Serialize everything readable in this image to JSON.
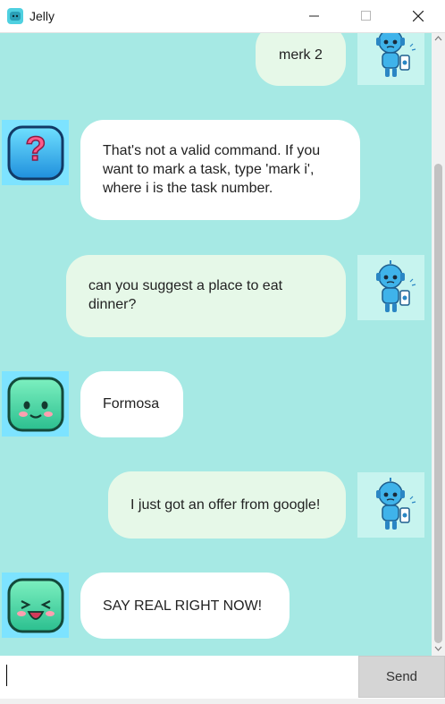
{
  "window": {
    "title": "Jelly",
    "icon": "jelly-app-icon"
  },
  "messages": [
    {
      "sender": "user",
      "text": "merk 2",
      "avatar": "robot-avatar"
    },
    {
      "sender": "bot",
      "lines": [
        "That's not a valid command. If you",
        "want to mark a task, type 'mark i',",
        "where i is the task number."
      ],
      "avatar": "confused-jelly-avatar"
    },
    {
      "sender": "user",
      "lines": [
        "can you suggest a place to eat",
        "dinner?"
      ],
      "avatar": "robot-avatar"
    },
    {
      "sender": "bot",
      "text": "Formosa",
      "avatar": "smiling-jelly-avatar"
    },
    {
      "sender": "user",
      "text": "I just got an offer from google!",
      "avatar": "robot-avatar"
    },
    {
      "sender": "bot",
      "text": "SAY REAL RIGHT NOW!",
      "avatar": "laughing-jelly-avatar"
    }
  ],
  "input": {
    "value": "",
    "send_label": "Send"
  },
  "colors": {
    "chat_background": "#a6e9e4",
    "user_bubble": "#e6f8e8",
    "bot_bubble": "#ffffff",
    "send_button": "#d5d5d5"
  }
}
